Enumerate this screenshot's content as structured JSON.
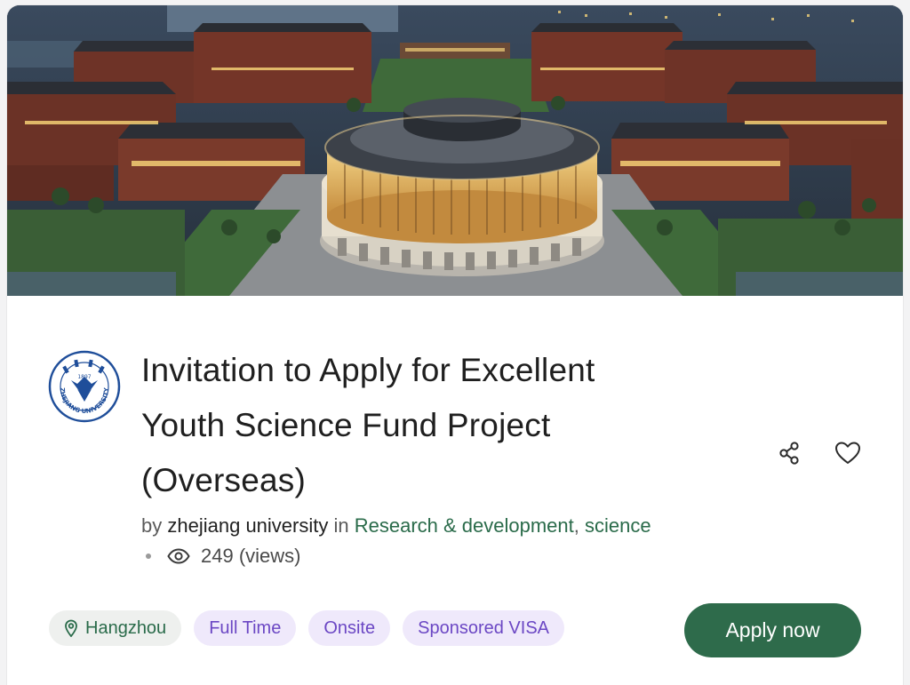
{
  "hero": {
    "image_alt": "Aerial view of a university campus with a circular lit library building at dusk"
  },
  "logo": {
    "caption": "ZHEJIANG UNIVERSITY",
    "year": "1897",
    "color": "#1f4e9a"
  },
  "job": {
    "title_lines": [
      "Invitation to Apply for Excellent",
      "Youth Science Fund Project",
      "(Overseas)"
    ],
    "by_label": "by",
    "organization": "zhejiang university",
    "in_label": "in",
    "categories": [
      "Research & development",
      "science"
    ],
    "category_separator": ",",
    "views": "249 (views)"
  },
  "actions": {
    "share_icon": "share-icon",
    "favorite_icon": "heart-icon"
  },
  "tags": [
    {
      "label": "Hangzhou",
      "kind": "location",
      "icon": "map-pin-icon"
    },
    {
      "label": "Full Time",
      "kind": "employment-type"
    },
    {
      "label": "Onsite",
      "kind": "workplace"
    },
    {
      "label": "Sponsored VISA",
      "kind": "visa"
    }
  ],
  "apply_button": {
    "label": "Apply now"
  },
  "colors": {
    "brand_green": "#2e6b4b",
    "category_green": "#2a6b4a",
    "tag_purple_bg": "#efe9fb",
    "tag_purple_text": "#6b47c4"
  }
}
